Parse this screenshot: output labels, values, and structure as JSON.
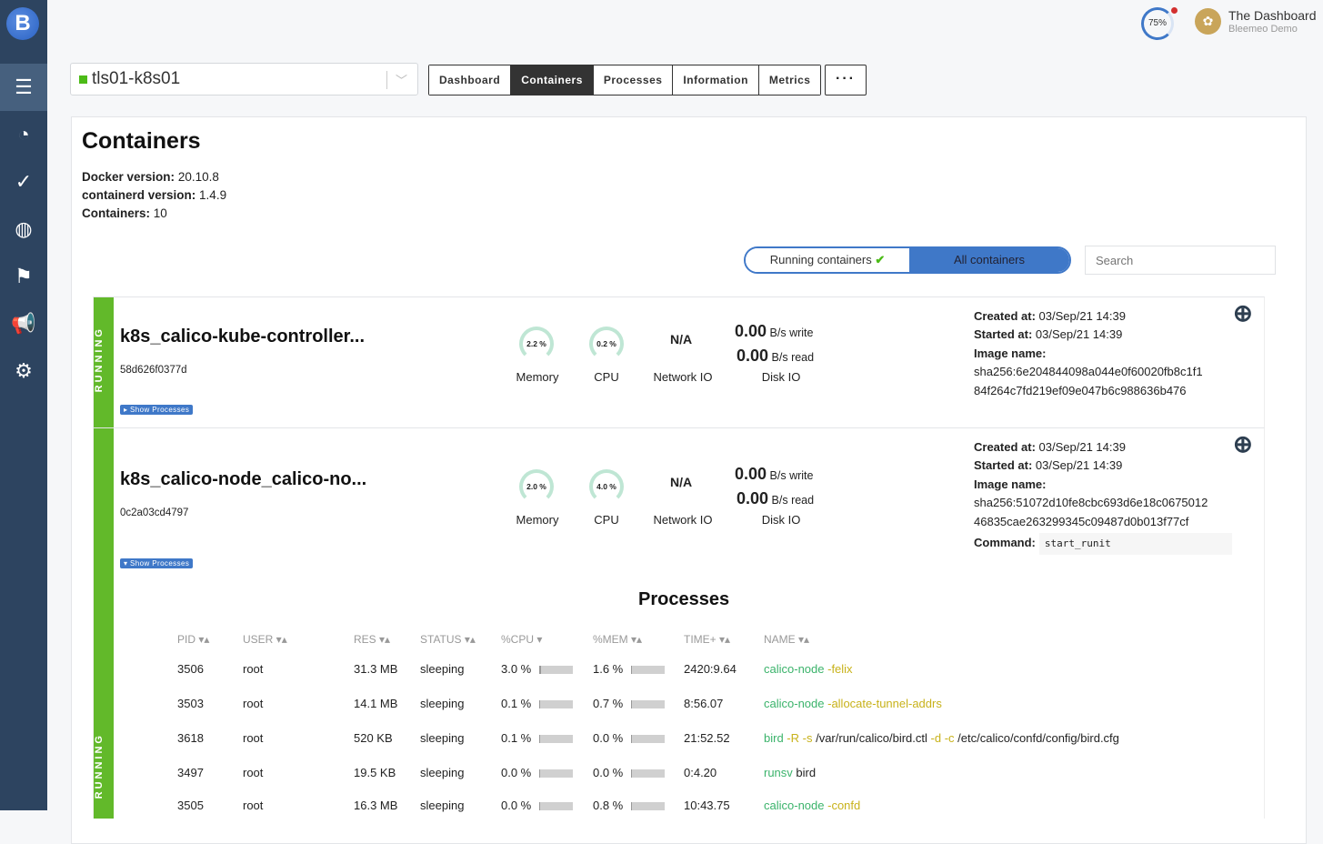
{
  "sidebar": {
    "logo": "B",
    "items": [
      {
        "icon": "server-icon",
        "glyph": "☰",
        "active": true
      },
      {
        "icon": "dashboard-icon",
        "glyph": "◔"
      },
      {
        "icon": "check-circle-icon",
        "glyph": "✓"
      },
      {
        "icon": "globe-icon",
        "glyph": "◍"
      },
      {
        "icon": "flag-icon",
        "glyph": "⚑"
      },
      {
        "icon": "megaphone-icon",
        "glyph": "📢"
      },
      {
        "icon": "gear-icon",
        "glyph": "⚙"
      }
    ]
  },
  "header": {
    "usage": "75%",
    "org_name": "The Dashboard",
    "org_sub": "Bleemeo Demo"
  },
  "agent_select": {
    "value": "tls01-k8s01",
    "status_color": "#4cbb17"
  },
  "tabs": [
    "Dashboard",
    "Containers",
    "Processes",
    "Information",
    "Metrics"
  ],
  "active_tab": "Containers",
  "more_label": "···",
  "page": {
    "title": "Containers",
    "docker_label": "Docker version:",
    "docker_value": "20.10.8",
    "containerd_label": "containerd version:",
    "containerd_value": "1.4.9",
    "count_label": "Containers:",
    "count_value": "10"
  },
  "filter": {
    "running": "Running containers",
    "running_check": "✔",
    "all": "All containers",
    "search_placeholder": "Search"
  },
  "labels": {
    "memory": "Memory",
    "cpu": "CPU",
    "network": "Network IO",
    "disk": "Disk IO",
    "write": "B/s write",
    "read": "B/s read",
    "created": "Created at:",
    "started": "Started at:",
    "image": "Image name:",
    "command": "Command:"
  },
  "containers": [
    {
      "status": "RUNNING",
      "name": "k8s_calico-kube-controller...",
      "id": "58d626f0377d",
      "show_processes": "▸ Show Processes",
      "memory": "2.2 %",
      "cpu": "0.2 %",
      "network": "N/A",
      "disk_write": "0.00",
      "disk_read": "0.00",
      "created": "03/Sep/21 14:39",
      "started": "03/Sep/21 14:39",
      "image_1": "sha256:6e204844098a044e0f60020fb8c1f1",
      "image_2": "84f264c7fd219ef09e047b6c988636b476"
    },
    {
      "status": "RUNNING",
      "name": "k8s_calico-node_calico-no...",
      "id": "0c2a03cd4797",
      "show_processes": "▾ Show Processes",
      "memory": "2.0 %",
      "cpu": "4.0 %",
      "network": "N/A",
      "disk_write": "0.00",
      "disk_read": "0.00",
      "created": "03/Sep/21 14:39",
      "started": "03/Sep/21 14:39",
      "image_1": "sha256:51072d10fe8cbc693d6e18c0675012",
      "image_2": "46835cae263299345c09487d0b013f77cf",
      "command": "start_runit"
    }
  ],
  "processes": {
    "title": "Processes",
    "columns": [
      "PID ▾▴",
      "USER ▾▴",
      "RES ▾▴",
      "STATUS ▾▴",
      "%CPU ▾",
      "%MEM ▾▴",
      "TIME+ ▾▴",
      "NAME ▾▴"
    ],
    "rows": [
      {
        "pid": "3506",
        "user": "root",
        "res": "31.3 MB",
        "status": "sleeping",
        "cpu": "3.0 %",
        "cpu_pct": 3.0,
        "mem": "1.6 %",
        "mem_pct": 1.6,
        "time": "2420:9.64",
        "name": [
          [
            "g",
            "calico-node"
          ],
          [
            "y",
            " -felix"
          ]
        ]
      },
      {
        "pid": "3503",
        "user": "root",
        "res": "14.1 MB",
        "status": "sleeping",
        "cpu": "0.1 %",
        "cpu_pct": 0.1,
        "mem": "0.7 %",
        "mem_pct": 0.7,
        "time": "8:56.07",
        "name": [
          [
            "g",
            "calico-node"
          ],
          [
            "y",
            " -allocate-tunnel-addrs"
          ]
        ]
      },
      {
        "pid": "3618",
        "user": "root",
        "res": "520 KB",
        "status": "sleeping",
        "cpu": "0.1 %",
        "cpu_pct": 0.1,
        "mem": "0.0 %",
        "mem_pct": 0.0,
        "time": "21:52.52",
        "name": [
          [
            "g",
            "bird"
          ],
          [
            "y",
            " -R -s"
          ],
          [
            "d",
            " /var/run/calico/bird.ctl"
          ],
          [
            "y",
            " -d -c"
          ],
          [
            "d",
            " /etc/calico/confd/config/bird.cfg"
          ]
        ]
      },
      {
        "pid": "3497",
        "user": "root",
        "res": "19.5 KB",
        "status": "sleeping",
        "cpu": "0.0 %",
        "cpu_pct": 0.0,
        "mem": "0.0 %",
        "mem_pct": 0.0,
        "time": "0:4.20",
        "name": [
          [
            "g",
            "runsv"
          ],
          [
            "d",
            " bird"
          ]
        ]
      },
      {
        "pid": "3505",
        "user": "root",
        "res": "16.3 MB",
        "status": "sleeping",
        "cpu": "0.0 %",
        "cpu_pct": 0.0,
        "mem": "0.8 %",
        "mem_pct": 0.8,
        "time": "10:43.75",
        "name": [
          [
            "g",
            "calico-node"
          ],
          [
            "y",
            " -confd"
          ]
        ]
      }
    ]
  }
}
